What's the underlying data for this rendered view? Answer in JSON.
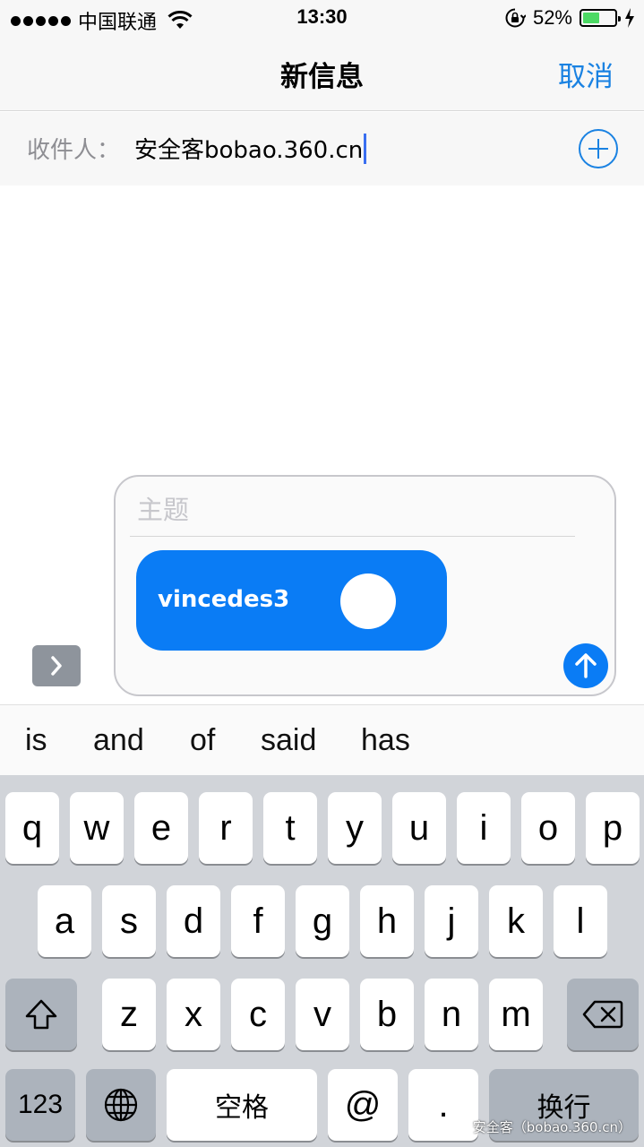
{
  "status_bar": {
    "carrier": "中国联通",
    "time": "13:30",
    "battery_percent": "52%",
    "battery_level": 0.52,
    "icons": [
      "signal-dots-icon",
      "wifi-icon",
      "rotation-lock-icon",
      "battery-icon",
      "charging-bolt-icon"
    ]
  },
  "nav": {
    "title": "新信息",
    "cancel_label": "取消"
  },
  "recipient": {
    "label": "收件人：",
    "value": "安全客bobao.360.cn",
    "add_icon": "plus-circle-icon"
  },
  "compose": {
    "subject_placeholder": "主题",
    "bubble_text": "vincedes3",
    "send_icon": "arrow-up-icon",
    "expand_icon": "chevron-right-icon"
  },
  "predictive": [
    "is",
    "and",
    "of",
    "said",
    "has"
  ],
  "keyboard": {
    "row1": [
      "q",
      "w",
      "e",
      "r",
      "t",
      "y",
      "u",
      "i",
      "o",
      "p"
    ],
    "row2": [
      "a",
      "s",
      "d",
      "f",
      "g",
      "h",
      "j",
      "k",
      "l"
    ],
    "row3": [
      "z",
      "x",
      "c",
      "v",
      "b",
      "n",
      "m"
    ],
    "numbers_label": "123",
    "space_label": "空格",
    "at_label": "@",
    "dot_label": ".",
    "return_label": "换行",
    "icons": [
      "shift-icon",
      "backspace-icon",
      "globe-icon"
    ]
  },
  "colors": {
    "accent": "#1a82e2",
    "bubble": "#0a7cf5",
    "battery": "#4cd964",
    "keyboard_bg": "#d1d4d9"
  },
  "watermark": "安全客（bobao.360.cn）"
}
